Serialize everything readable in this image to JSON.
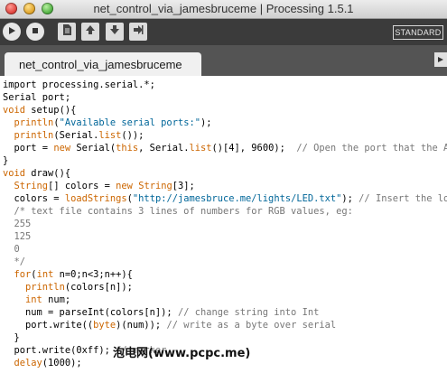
{
  "window": {
    "title": "net_control_via_jamesbruceme | Processing 1.5.1"
  },
  "toolbar": {
    "buttons": [
      {
        "icon": "play-icon"
      },
      {
        "icon": "stop-icon"
      },
      {
        "icon": "new-file-icon"
      },
      {
        "icon": "open-icon"
      },
      {
        "icon": "save-icon"
      },
      {
        "icon": "export-icon"
      }
    ],
    "mode_label": "STANDARD"
  },
  "tabs": [
    {
      "label": "net_control_via_jamesbruceme"
    }
  ],
  "code": [
    [
      {
        "t": "import processing.serial.*;",
        "c": "plain"
      }
    ],
    [
      {
        "t": "Serial port;",
        "c": "plain"
      }
    ],
    [
      {
        "t": "void",
        "c": "kw"
      },
      {
        "t": " setup(){",
        "c": "plain"
      }
    ],
    [
      {
        "t": "  ",
        "c": "plain"
      },
      {
        "t": "println",
        "c": "fn"
      },
      {
        "t": "(",
        "c": "plain"
      },
      {
        "t": "\"Available serial ports:\"",
        "c": "str"
      },
      {
        "t": ");",
        "c": "plain"
      }
    ],
    [
      {
        "t": "  ",
        "c": "plain"
      },
      {
        "t": "println",
        "c": "fn"
      },
      {
        "t": "(Serial.",
        "c": "plain"
      },
      {
        "t": "list",
        "c": "fn"
      },
      {
        "t": "());",
        "c": "plain"
      }
    ],
    [
      {
        "t": "  port = ",
        "c": "plain"
      },
      {
        "t": "new",
        "c": "kw"
      },
      {
        "t": " Serial(",
        "c": "plain"
      },
      {
        "t": "this",
        "c": "kw"
      },
      {
        "t": ", Serial.",
        "c": "plain"
      },
      {
        "t": "list",
        "c": "fn"
      },
      {
        "t": "()[4], 9600);  ",
        "c": "plain"
      },
      {
        "t": "// Open the port that the Ardu",
        "c": "cm"
      }
    ],
    [
      {
        "t": "}",
        "c": "plain"
      }
    ],
    [
      {
        "t": "void",
        "c": "kw"
      },
      {
        "t": " draw(){",
        "c": "plain"
      }
    ],
    [
      {
        "t": "  ",
        "c": "plain"
      },
      {
        "t": "String",
        "c": "ty"
      },
      {
        "t": "[] colors = ",
        "c": "plain"
      },
      {
        "t": "new",
        "c": "kw"
      },
      {
        "t": " ",
        "c": "plain"
      },
      {
        "t": "String",
        "c": "ty"
      },
      {
        "t": "[3];",
        "c": "plain"
      }
    ],
    [
      {
        "t": "  colors = ",
        "c": "plain"
      },
      {
        "t": "loadStrings",
        "c": "fn"
      },
      {
        "t": "(",
        "c": "plain"
      },
      {
        "t": "\"http://jamesbruce.me/lights/LED.txt\"",
        "c": "str"
      },
      {
        "t": "); ",
        "c": "plain"
      },
      {
        "t": "// Insert the locat",
        "c": "cm"
      }
    ],
    [
      {
        "t": "  /* text file contains 3 lines of numbers for RGB values, eg:",
        "c": "cm"
      }
    ],
    [
      {
        "t": "  255",
        "c": "cm"
      }
    ],
    [
      {
        "t": "  125",
        "c": "cm"
      }
    ],
    [
      {
        "t": "  0",
        "c": "cm"
      }
    ],
    [
      {
        "t": "  */",
        "c": "cm"
      }
    ],
    [
      {
        "t": "  ",
        "c": "plain"
      },
      {
        "t": "for",
        "c": "kw"
      },
      {
        "t": "(",
        "c": "plain"
      },
      {
        "t": "int",
        "c": "ty"
      },
      {
        "t": " n=0;n<3;n++){",
        "c": "plain"
      }
    ],
    [
      {
        "t": "    ",
        "c": "plain"
      },
      {
        "t": "println",
        "c": "fn"
      },
      {
        "t": "(colors[n]);",
        "c": "plain"
      }
    ],
    [
      {
        "t": "    ",
        "c": "plain"
      },
      {
        "t": "int",
        "c": "ty"
      },
      {
        "t": " num;",
        "c": "plain"
      }
    ],
    [
      {
        "t": "    num = parseInt(colors[n]); ",
        "c": "plain"
      },
      {
        "t": "// change string into Int",
        "c": "cm"
      }
    ],
    [
      {
        "t": "    port.write((",
        "c": "plain"
      },
      {
        "t": "byte",
        "c": "ty"
      },
      {
        "t": ")(num)); ",
        "c": "plain"
      },
      {
        "t": "// write as a byte over serial",
        "c": "cm"
      }
    ],
    [
      {
        "t": "  }",
        "c": "plain"
      }
    ],
    [
      {
        "t": "  port.write(0xff); ",
        "c": "plain"
      },
      {
        "t": "// marker",
        "c": "cm"
      }
    ],
    [
      {
        "t": "  ",
        "c": "plain"
      },
      {
        "t": "delay",
        "c": "fn"
      },
      {
        "t": "(1000);",
        "c": "plain"
      }
    ]
  ],
  "watermark": "泡电网(www.pcpc.me)"
}
